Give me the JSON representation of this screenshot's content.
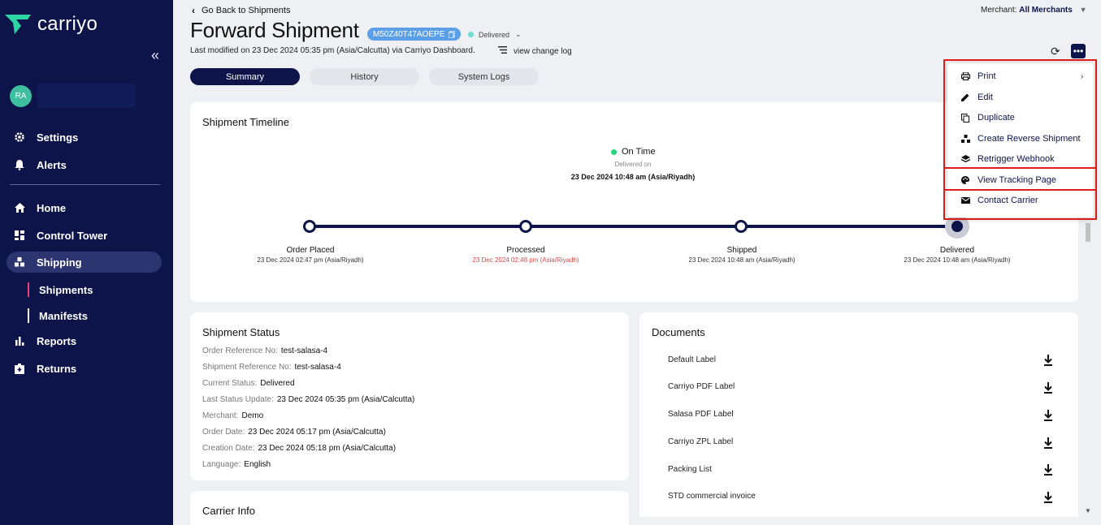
{
  "brand": {
    "name": "carriyo"
  },
  "sidebar": {
    "user_initials": "RA",
    "top_items": [
      {
        "label": "Settings",
        "icon": "gear-icon"
      },
      {
        "label": "Alerts",
        "icon": "bell-icon"
      }
    ],
    "items": [
      {
        "label": "Home",
        "icon": "home-icon"
      },
      {
        "label": "Control Tower",
        "icon": "dashboard-icon"
      },
      {
        "label": "Shipping",
        "icon": "shipping-icon"
      },
      {
        "label": "Reports",
        "icon": "bar-chart-icon"
      },
      {
        "label": "Returns",
        "icon": "returns-icon"
      }
    ],
    "sub_items": [
      {
        "label": "Shipments"
      },
      {
        "label": "Manifests"
      }
    ]
  },
  "header": {
    "back_label": "Go Back to Shipments",
    "title": "Forward Shipment",
    "shipment_id": "M50Z40T47AOEPE",
    "status": "Delivered",
    "last_modified": "Last modified on 23 Dec 2024 05:35 pm (Asia/Calcutta) via Carriyo Dashboard.",
    "change_log_label": "view change log",
    "merchant_label": "Merchant:",
    "merchant_value": "All Merchants"
  },
  "tabs": [
    {
      "label": "Summary"
    },
    {
      "label": "History"
    },
    {
      "label": "System Logs"
    }
  ],
  "timeline": {
    "title": "Shipment Timeline",
    "on_time_label": "On Time",
    "delivered_on_label": "Delivered on",
    "delivered_date": "23 Dec 2024 10:48 am (Asia/Riyadh)",
    "steps": [
      {
        "label": "Order Placed",
        "date": "23 Dec 2024 02:47 pm (Asia/Riyadh)"
      },
      {
        "label": "Processed",
        "date": "23 Dec 2024 02:48 pm (Asia/Riyadh)"
      },
      {
        "label": "Shipped",
        "date": "23 Dec 2024 10:48 am (Asia/Riyadh)"
      },
      {
        "label": "Delivered",
        "date": "23 Dec 2024 10:48 am (Asia/Riyadh)"
      }
    ]
  },
  "shipment_status": {
    "title": "Shipment Status",
    "fields": [
      {
        "label": "Order Reference No:",
        "value": "test-salasa-4"
      },
      {
        "label": "Shipment Reference No:",
        "value": "test-salasa-4"
      },
      {
        "label": "Current Status:",
        "value": "Delivered"
      },
      {
        "label": "Last Status Update:",
        "value": "23 Dec 2024 05:35 pm (Asia/Calcutta)"
      },
      {
        "label": "Merchant:",
        "value": "Demo"
      },
      {
        "label": "Order Date:",
        "value": "23 Dec 2024 05:17 pm (Asia/Calcutta)"
      },
      {
        "label": "Creation Date:",
        "value": "23 Dec 2024 05:18 pm (Asia/Calcutta)"
      },
      {
        "label": "Language:",
        "value": "English"
      }
    ]
  },
  "carrier_info": {
    "title": "Carrier Info"
  },
  "documents": {
    "title": "Documents",
    "items": [
      {
        "label": "Default Label"
      },
      {
        "label": "Carriyo PDF Label"
      },
      {
        "label": "Salasa PDF Label"
      },
      {
        "label": "Carriyo ZPL Label"
      },
      {
        "label": "Packing List"
      },
      {
        "label": "STD commercial invoice"
      }
    ]
  },
  "menu": {
    "items": [
      {
        "label": "Print",
        "icon": "printer-icon"
      },
      {
        "label": "Edit",
        "icon": "pencil-icon"
      },
      {
        "label": "Duplicate",
        "icon": "copy-icon"
      },
      {
        "label": "Create Reverse Shipment",
        "icon": "hierarchy-icon"
      },
      {
        "label": "Retrigger Webhook",
        "icon": "layers-icon"
      },
      {
        "label": "View Tracking Page",
        "icon": "palette-icon"
      },
      {
        "label": "Contact Carrier",
        "icon": "mail-icon"
      }
    ]
  },
  "colors": {
    "sidebar_bg": "#0c1449",
    "accent": "#0c1449",
    "highlight": "#e01a1a",
    "on_time": "#24d67e",
    "late": "#e04646"
  }
}
